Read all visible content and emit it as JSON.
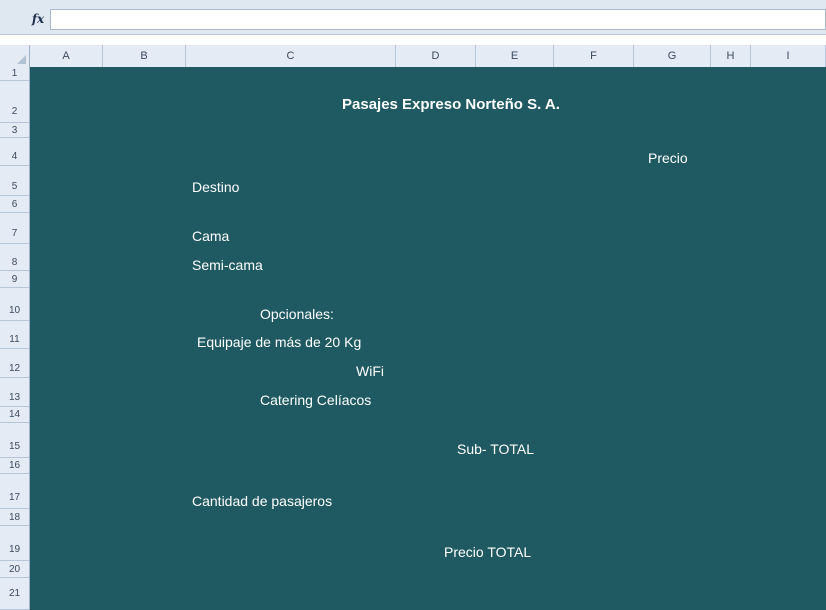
{
  "formula_bar": {
    "fx_label": "fx",
    "value": ""
  },
  "columns": [
    "A",
    "B",
    "C",
    "D",
    "E",
    "F",
    "G",
    "H",
    "I"
  ],
  "rows": [
    "1",
    "2",
    "3",
    "4",
    "5",
    "6",
    "7",
    "8",
    "9",
    "10",
    "11",
    "12",
    "13",
    "14",
    "15",
    "16",
    "17",
    "18",
    "19",
    "20",
    "21"
  ],
  "sheet": {
    "title": "Pasajes Expreso Norteño S. A.",
    "precio": "Precio",
    "destino": "Destino",
    "cama": "Cama",
    "semicama": "Semi-cama",
    "opcionales": "Opcionales:",
    "equipaje": "Equipaje de más de 20 Kg",
    "wifi": "WiFi",
    "catering": "Catering Celíacos",
    "subtotal": "Sub- TOTAL",
    "cantidad": "Cantidad de pasajeros",
    "total": "Precio TOTAL"
  },
  "colors": {
    "grid_fill": "#1f5962",
    "text": "#ffffff",
    "header_bg": "#e4ebf5"
  }
}
